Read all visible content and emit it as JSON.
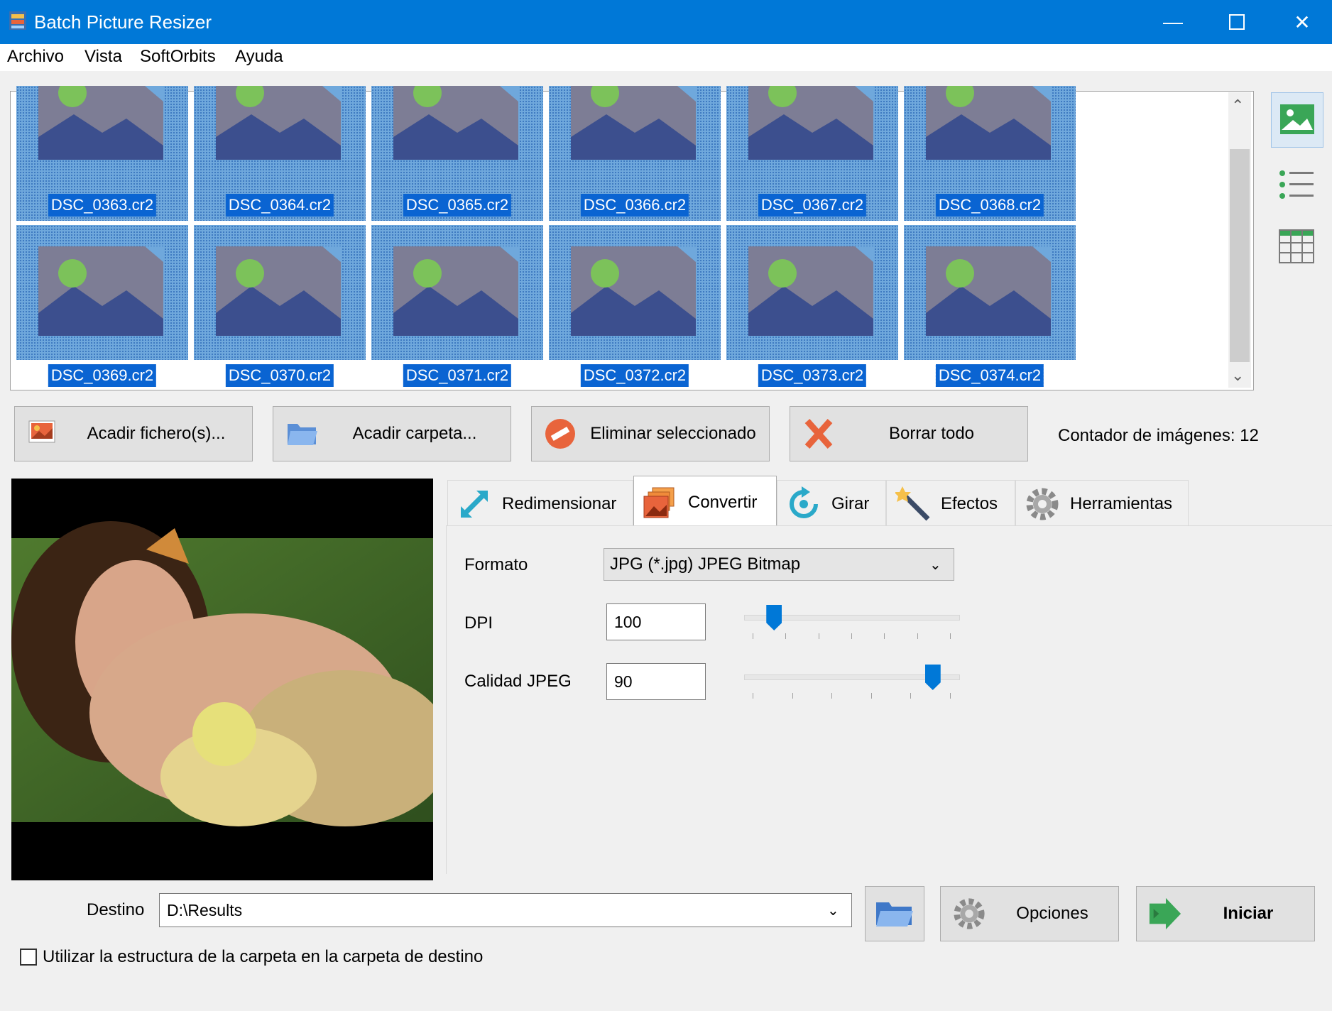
{
  "window": {
    "title": "Batch Picture Resizer"
  },
  "menu": [
    "Archivo",
    "Vista",
    "SoftOrbits",
    "Ayuda"
  ],
  "thumbnails": [
    "DSC_0363.cr2",
    "DSC_0364.cr2",
    "DSC_0365.cr2",
    "DSC_0366.cr2",
    "DSC_0367.cr2",
    "DSC_0368.cr2",
    "DSC_0369.cr2",
    "DSC_0370.cr2",
    "DSC_0371.cr2",
    "DSC_0372.cr2",
    "DSC_0373.cr2",
    "DSC_0374.cr2"
  ],
  "actions": {
    "add_files": "Acadir fichero(s)...",
    "add_folder": "Acadir carpeta...",
    "remove_selected": "Eliminar seleccionado",
    "clear_all": "Borrar todo",
    "counter": "Contador de imágenes: 12"
  },
  "tabs": [
    "Redimensionar",
    "Convertir",
    "Girar",
    "Efectos",
    "Herramientas"
  ],
  "active_tab": "Convertir",
  "convert": {
    "format_label": "Formato",
    "format_value": "JPG (*.jpg) JPEG Bitmap",
    "dpi_label": "DPI",
    "dpi_value": "100",
    "dpi_slider_fraction": 0.14,
    "quality_label": "Calidad JPEG",
    "quality_value": "90",
    "quality_slider_fraction": 0.88
  },
  "destination": {
    "label": "Destino",
    "value": "D:\\Results",
    "options_button": "Opciones",
    "start_button": "Iniciar",
    "folder_structure_checkbox": "Utilizar la estructura de la carpeta en la carpeta de destino",
    "folder_structure_checked": false
  },
  "colors": {
    "titlebar": "#0078d7",
    "selection": "#0a64d2",
    "accent": "#0078d7"
  }
}
